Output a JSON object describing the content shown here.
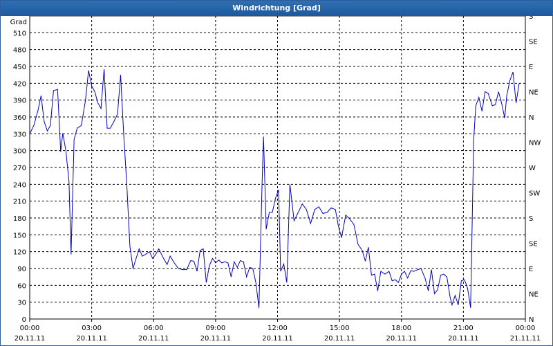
{
  "window": {
    "title": "Windrichtung [Grad]"
  },
  "chart_data": {
    "type": "line",
    "title": "Windrichtung [Grad]",
    "ylabel": "Grad",
    "xlabel": "",
    "x_unit": "hours since 00:00 20.11.11",
    "ylim": [
      0,
      540
    ],
    "xlim": [
      0,
      24
    ],
    "grid": true,
    "line_color": "#0000cc",
    "y_ticks": [
      0,
      30,
      60,
      90,
      120,
      150,
      180,
      210,
      240,
      270,
      300,
      330,
      360,
      390,
      420,
      450,
      480,
      510
    ],
    "y_tick_labels": [
      "0",
      "30",
      "60",
      "90",
      "120",
      "150",
      "180",
      "210",
      "240",
      "270",
      "300",
      "330",
      "360",
      "390",
      "420",
      "450",
      "480",
      "510"
    ],
    "right_axis_labels": [
      "N",
      "NE",
      "E",
      "SE",
      "S",
      "SW",
      "W",
      "NW",
      "N",
      "NE",
      "E",
      "SE",
      "S"
    ],
    "right_axis_values": [
      0,
      45,
      90,
      135,
      180,
      225,
      270,
      315,
      360,
      405,
      450,
      495,
      540
    ],
    "x_ticks": [
      {
        "h": 0,
        "time": "00:00",
        "date": "20.11.11"
      },
      {
        "h": 3,
        "time": "03:00",
        "date": "20.11.11"
      },
      {
        "h": 6,
        "time": "06:00",
        "date": "20.11.11"
      },
      {
        "h": 9,
        "time": "09:00",
        "date": "20.11.11"
      },
      {
        "h": 12,
        "time": "12:00",
        "date": "20.11.11"
      },
      {
        "h": 15,
        "time": "15:00",
        "date": "20.11.11"
      },
      {
        "h": 18,
        "time": "18:00",
        "date": "20.11.11"
      },
      {
        "h": 21,
        "time": "21:00",
        "date": "20.11.11"
      },
      {
        "h": 24,
        "time": "00:00",
        "date": "21.11.11"
      }
    ],
    "series": [
      {
        "name": "Windrichtung",
        "points": [
          [
            0.0,
            330
          ],
          [
            0.2,
            345
          ],
          [
            0.4,
            372
          ],
          [
            0.55,
            398
          ],
          [
            0.7,
            352
          ],
          [
            0.85,
            335
          ],
          [
            1.0,
            345
          ],
          [
            1.15,
            407
          ],
          [
            1.35,
            409
          ],
          [
            1.5,
            298
          ],
          [
            1.6,
            331
          ],
          [
            1.75,
            300
          ],
          [
            1.9,
            245
          ],
          [
            2.0,
            115
          ],
          [
            2.15,
            320
          ],
          [
            2.3,
            340
          ],
          [
            2.5,
            345
          ],
          [
            2.7,
            390
          ],
          [
            2.85,
            443
          ],
          [
            3.0,
            415
          ],
          [
            3.15,
            405
          ],
          [
            3.3,
            385
          ],
          [
            3.45,
            375
          ],
          [
            3.6,
            445
          ],
          [
            3.75,
            340
          ],
          [
            3.9,
            340
          ],
          [
            4.05,
            350
          ],
          [
            4.25,
            365
          ],
          [
            4.4,
            435
          ],
          [
            4.55,
            330
          ],
          [
            4.7,
            240
          ],
          [
            4.85,
            130
          ],
          [
            5.0,
            90
          ],
          [
            5.15,
            108
          ],
          [
            5.3,
            125
          ],
          [
            5.45,
            112
          ],
          [
            5.6,
            115
          ],
          [
            5.8,
            120
          ],
          [
            5.95,
            108
          ],
          [
            6.1,
            115
          ],
          [
            6.25,
            125
          ],
          [
            6.45,
            110
          ],
          [
            6.65,
            97
          ],
          [
            6.8,
            112
          ],
          [
            7.0,
            100
          ],
          [
            7.2,
            90
          ],
          [
            7.4,
            88
          ],
          [
            7.6,
            88
          ],
          [
            7.8,
            104
          ],
          [
            7.95,
            103
          ],
          [
            8.1,
            85
          ],
          [
            8.25,
            122
          ],
          [
            8.4,
            125
          ],
          [
            8.55,
            65
          ],
          [
            8.7,
            95
          ],
          [
            8.85,
            108
          ],
          [
            9.0,
            100
          ],
          [
            9.15,
            105
          ],
          [
            9.3,
            100
          ],
          [
            9.45,
            102
          ],
          [
            9.6,
            100
          ],
          [
            9.75,
            75
          ],
          [
            9.9,
            102
          ],
          [
            10.05,
            92
          ],
          [
            10.2,
            104
          ],
          [
            10.35,
            102
          ],
          [
            10.5,
            75
          ],
          [
            10.65,
            92
          ],
          [
            10.8,
            90
          ],
          [
            10.95,
            65
          ],
          [
            11.1,
            20
          ],
          [
            11.25,
            240
          ],
          [
            11.32,
            325
          ],
          [
            11.45,
            160
          ],
          [
            11.6,
            190
          ],
          [
            11.75,
            190
          ],
          [
            11.9,
            215
          ],
          [
            12.05,
            230
          ],
          [
            12.15,
            85
          ],
          [
            12.3,
            98
          ],
          [
            12.45,
            65
          ],
          [
            12.6,
            240
          ],
          [
            12.8,
            175
          ],
          [
            13.0,
            190
          ],
          [
            13.2,
            205
          ],
          [
            13.4,
            195
          ],
          [
            13.6,
            170
          ],
          [
            13.8,
            195
          ],
          [
            14.0,
            200
          ],
          [
            14.2,
            188
          ],
          [
            14.4,
            190
          ],
          [
            14.6,
            198
          ],
          [
            14.8,
            195
          ],
          [
            14.95,
            165
          ],
          [
            15.1,
            145
          ],
          [
            15.3,
            185
          ],
          [
            15.5,
            178
          ],
          [
            15.7,
            168
          ],
          [
            15.9,
            133
          ],
          [
            16.1,
            122
          ],
          [
            16.25,
            103
          ],
          [
            16.4,
            128
          ],
          [
            16.55,
            78
          ],
          [
            16.7,
            80
          ],
          [
            16.85,
            50
          ],
          [
            17.0,
            85
          ],
          [
            17.2,
            80
          ],
          [
            17.4,
            85
          ],
          [
            17.55,
            68
          ],
          [
            17.7,
            70
          ],
          [
            17.85,
            65
          ],
          [
            18.0,
            80
          ],
          [
            18.15,
            85
          ],
          [
            18.3,
            73
          ],
          [
            18.45,
            86
          ],
          [
            18.6,
            85
          ],
          [
            18.8,
            88
          ],
          [
            18.95,
            90
          ],
          [
            19.15,
            72
          ],
          [
            19.3,
            50
          ],
          [
            19.45,
            88
          ],
          [
            19.6,
            45
          ],
          [
            19.75,
            52
          ],
          [
            19.9,
            78
          ],
          [
            20.05,
            80
          ],
          [
            20.2,
            75
          ],
          [
            20.35,
            40
          ],
          [
            20.45,
            25
          ],
          [
            20.6,
            42
          ],
          [
            20.75,
            25
          ],
          [
            20.9,
            68
          ],
          [
            21.05,
            70
          ],
          [
            21.2,
            55
          ],
          [
            21.35,
            20
          ],
          [
            21.5,
            320
          ],
          [
            21.6,
            380
          ],
          [
            21.75,
            395
          ],
          [
            21.9,
            370
          ],
          [
            22.05,
            405
          ],
          [
            22.2,
            402
          ],
          [
            22.4,
            380
          ],
          [
            22.55,
            382
          ],
          [
            22.7,
            405
          ],
          [
            22.85,
            385
          ],
          [
            23.0,
            358
          ],
          [
            23.1,
            398
          ],
          [
            23.25,
            425
          ],
          [
            23.4,
            440
          ],
          [
            23.55,
            385
          ],
          [
            23.7,
            420
          ]
        ]
      }
    ]
  }
}
